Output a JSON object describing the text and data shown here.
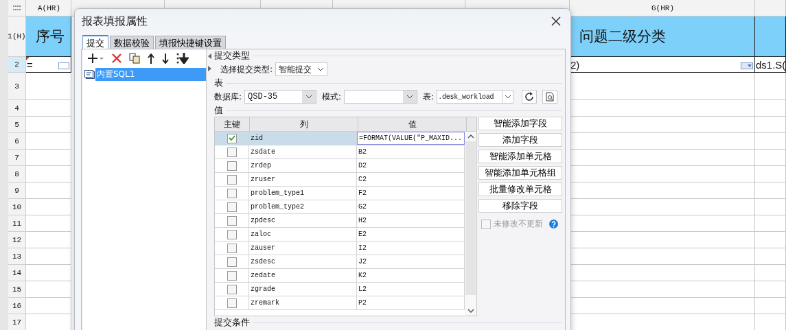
{
  "sheet": {
    "column_a": {
      "header": "A(HR)",
      "title": "序号",
      "formula": "="
    },
    "column_g": {
      "header": "G(HR)",
      "title": "问题二级分类",
      "formula": "2)"
    },
    "column_h": {
      "formula": "ds1.S("
    },
    "rows": [
      {
        "label": "1(H)",
        "selected": false
      },
      {
        "label": "2",
        "selected": true
      },
      {
        "label": "3",
        "selected": false
      },
      {
        "label": "4",
        "selected": false
      },
      {
        "label": "5",
        "selected": false
      },
      {
        "label": "6",
        "selected": false
      },
      {
        "label": "7",
        "selected": false
      },
      {
        "label": "8",
        "selected": false
      },
      {
        "label": "9",
        "selected": false
      },
      {
        "label": "10",
        "selected": false
      },
      {
        "label": "11",
        "selected": false
      },
      {
        "label": "12",
        "selected": false
      },
      {
        "label": "13",
        "selected": false
      },
      {
        "label": "14",
        "selected": false
      },
      {
        "label": "15",
        "selected": false
      },
      {
        "label": "16",
        "selected": false
      },
      {
        "label": "17",
        "selected": false
      }
    ]
  },
  "dialog": {
    "title": "报表填报属性",
    "tabs": [
      {
        "label": "提交",
        "selected": true
      },
      {
        "label": "数据校验",
        "selected": false
      },
      {
        "label": "填报快捷键设置",
        "selected": false
      }
    ],
    "submit_items": [
      {
        "label": "内置SQL1",
        "selected": true
      }
    ],
    "submit_type": {
      "heading": "提交类型",
      "label": "选择提交类型:",
      "value": "智能提交"
    },
    "table_section": {
      "heading": "表",
      "database_label": "数据库:",
      "database": "QSD-35",
      "schema_label": "模式:",
      "table_label": "表:",
      "table": ".desk_workload"
    },
    "values": {
      "heading": "值",
      "columns": [
        "主键",
        "列",
        "值"
      ],
      "rows": [
        {
          "key": true,
          "column": "zid",
          "value": "=FORMAT(VALUE(\"P_MAXID...",
          "selected": true
        },
        {
          "key": false,
          "column": "zsdate",
          "value": "B2",
          "selected": false
        },
        {
          "key": false,
          "column": "zrdep",
          "value": "D2",
          "selected": false
        },
        {
          "key": false,
          "column": "zruser",
          "value": "C2",
          "selected": false
        },
        {
          "key": false,
          "column": "problem_type1",
          "value": "F2",
          "selected": false
        },
        {
          "key": false,
          "column": "problem_type2",
          "value": "G2",
          "selected": false
        },
        {
          "key": false,
          "column": "zpdesc",
          "value": "H2",
          "selected": false
        },
        {
          "key": false,
          "column": "zaloc",
          "value": "E2",
          "selected": false
        },
        {
          "key": false,
          "column": "zauser",
          "value": "I2",
          "selected": false
        },
        {
          "key": false,
          "column": "zsdesc",
          "value": "J2",
          "selected": false
        },
        {
          "key": false,
          "column": "zedate",
          "value": "K2",
          "selected": false
        },
        {
          "key": false,
          "column": "zgrade",
          "value": "L2",
          "selected": false
        },
        {
          "key": false,
          "column": "zremark",
          "value": "P2",
          "selected": false
        }
      ]
    },
    "buttons": [
      "智能添加字段",
      "添加字段",
      "智能添加单元格",
      "智能添加单元格组",
      "批量修改单元格",
      "移除字段"
    ],
    "unchanged_option": {
      "label": "未修改不更新",
      "checked": false,
      "disabled": true
    },
    "condition_heading": "提交条件"
  }
}
